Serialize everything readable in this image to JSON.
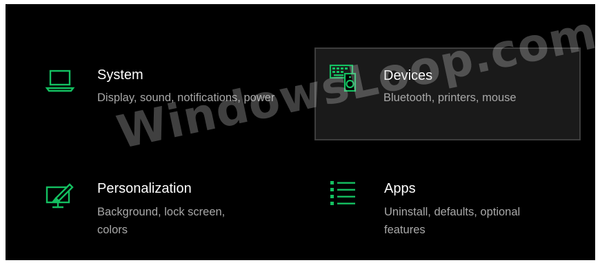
{
  "settings": {
    "accent_color": "#14c061",
    "tiles": [
      {
        "title": "System",
        "description": "Display, sound, notifications, power",
        "icon": "laptop-icon"
      },
      {
        "title": "Devices",
        "description": "Bluetooth, printers, mouse",
        "icon": "devices-icon"
      },
      {
        "title": "Personalization",
        "description": "Background, lock screen, colors",
        "icon": "personalization-icon"
      },
      {
        "title": "Apps",
        "description": "Uninstall, defaults, optional features",
        "icon": "apps-list-icon"
      }
    ]
  },
  "watermark": "WindowsLoop.com"
}
